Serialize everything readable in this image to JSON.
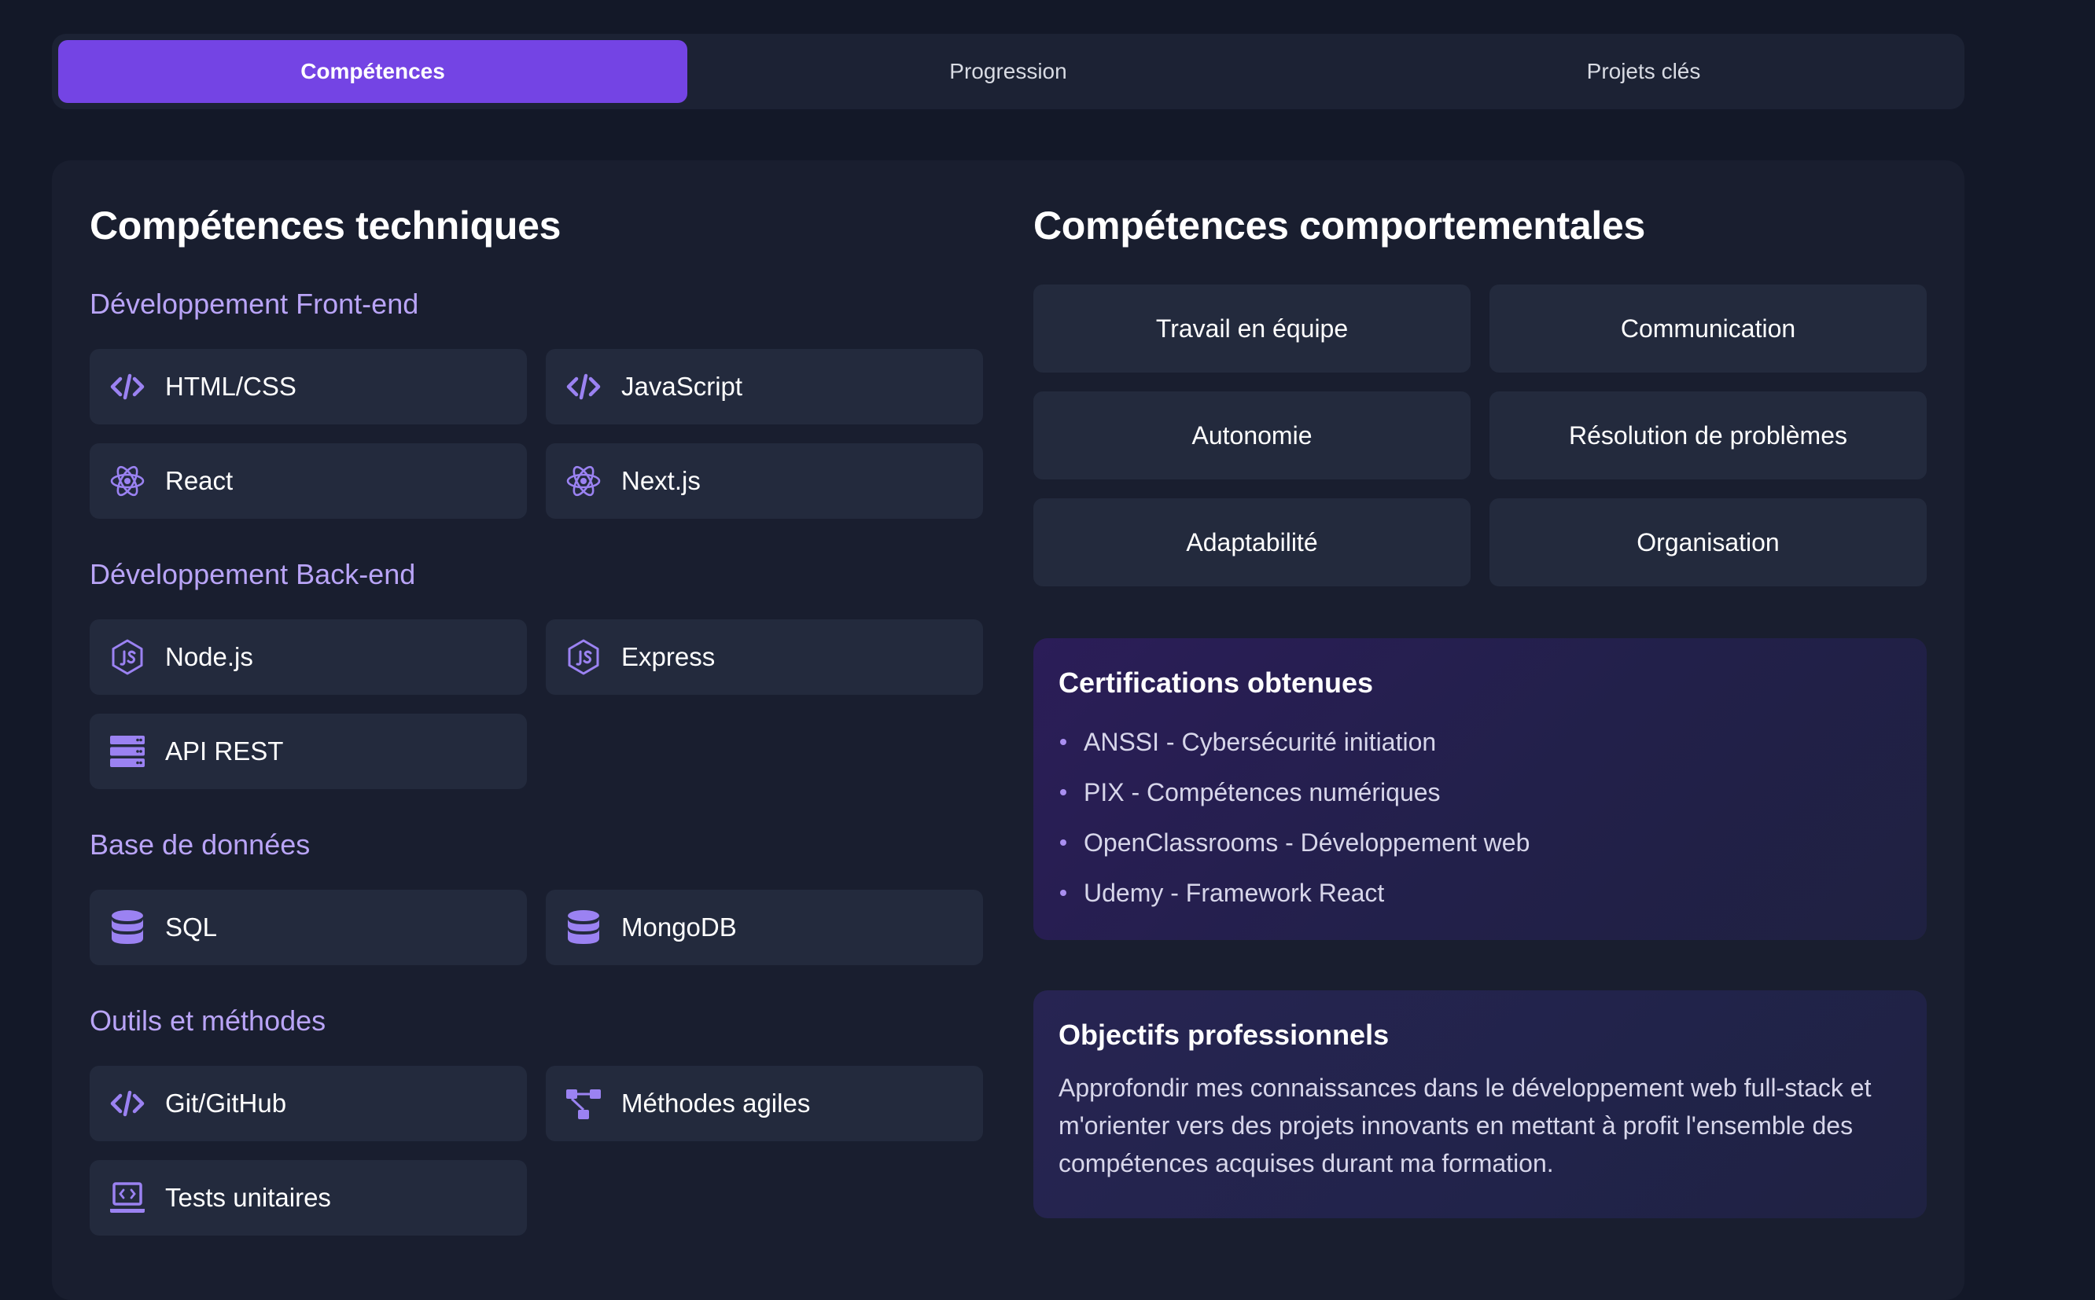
{
  "tabs": [
    {
      "label": "Compétences",
      "active": true
    },
    {
      "label": "Progression",
      "active": false
    },
    {
      "label": "Projets clés",
      "active": false
    }
  ],
  "technical": {
    "title": "Compétences techniques",
    "groups": [
      {
        "title": "Développement Front-end",
        "items": [
          {
            "label": "HTML/CSS",
            "icon": "code-icon"
          },
          {
            "label": "JavaScript",
            "icon": "code-icon"
          },
          {
            "label": "React",
            "icon": "atom-icon"
          },
          {
            "label": "Next.js",
            "icon": "atom-icon"
          }
        ]
      },
      {
        "title": "Développement Back-end",
        "items": [
          {
            "label": "Node.js",
            "icon": "nodejs-icon"
          },
          {
            "label": "Express",
            "icon": "nodejs-icon"
          },
          {
            "label": "API REST",
            "icon": "server-icon"
          }
        ]
      },
      {
        "title": "Base de données",
        "items": [
          {
            "label": "SQL",
            "icon": "database-icon"
          },
          {
            "label": "MongoDB",
            "icon": "database-icon"
          }
        ]
      },
      {
        "title": "Outils et méthodes",
        "items": [
          {
            "label": "Git/GitHub",
            "icon": "code-icon"
          },
          {
            "label": "Méthodes agiles",
            "icon": "workflow-icon"
          },
          {
            "label": "Tests unitaires",
            "icon": "laptop-code-icon"
          }
        ]
      }
    ]
  },
  "behavioral": {
    "title": "Compétences comportementales",
    "items": [
      "Travail en équipe",
      "Communication",
      "Autonomie",
      "Résolution de problèmes",
      "Adaptabilité",
      "Organisation"
    ]
  },
  "certifications": {
    "title": "Certifications obtenues",
    "items": [
      "ANSSI - Cybersécurité initiation",
      "PIX - Compétences numériques",
      "OpenClassrooms - Développement web",
      "Udemy - Framework React"
    ]
  },
  "goals": {
    "title": "Objectifs professionnels",
    "text": "Approfondir mes connaissances dans le développement web full-stack et m'orienter vers des projets innovants en mettant à profit l'ensemble des compétences acquises durant ma formation."
  },
  "colors": {
    "accent": "#7444e4",
    "icon": "#9b82f2",
    "group_title": "#b9a4f7",
    "background": "#131828"
  }
}
